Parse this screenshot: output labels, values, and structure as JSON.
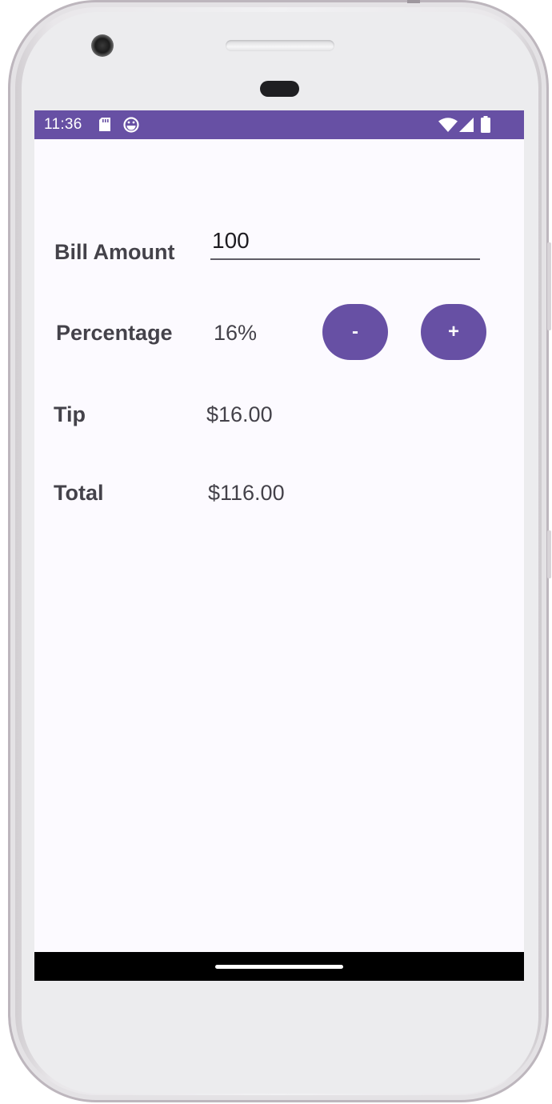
{
  "status_bar": {
    "time": "11:36",
    "icons": [
      "sd-card-icon",
      "debug-icon",
      "wifi-icon",
      "signal-icon",
      "battery-icon"
    ],
    "background_color": "#6750a4"
  },
  "form": {
    "bill_label": "Bill Amount",
    "bill_value": "100",
    "percentage_label": "Percentage",
    "percentage_value": "16%",
    "decrease_label": "-",
    "increase_label": "+",
    "tip_label": "Tip",
    "tip_value": "$16.00",
    "total_label": "Total",
    "total_value": "$116.00"
  },
  "colors": {
    "accent": "#6750a4",
    "text": "#44424a",
    "screen_background": "#fcfaff"
  }
}
